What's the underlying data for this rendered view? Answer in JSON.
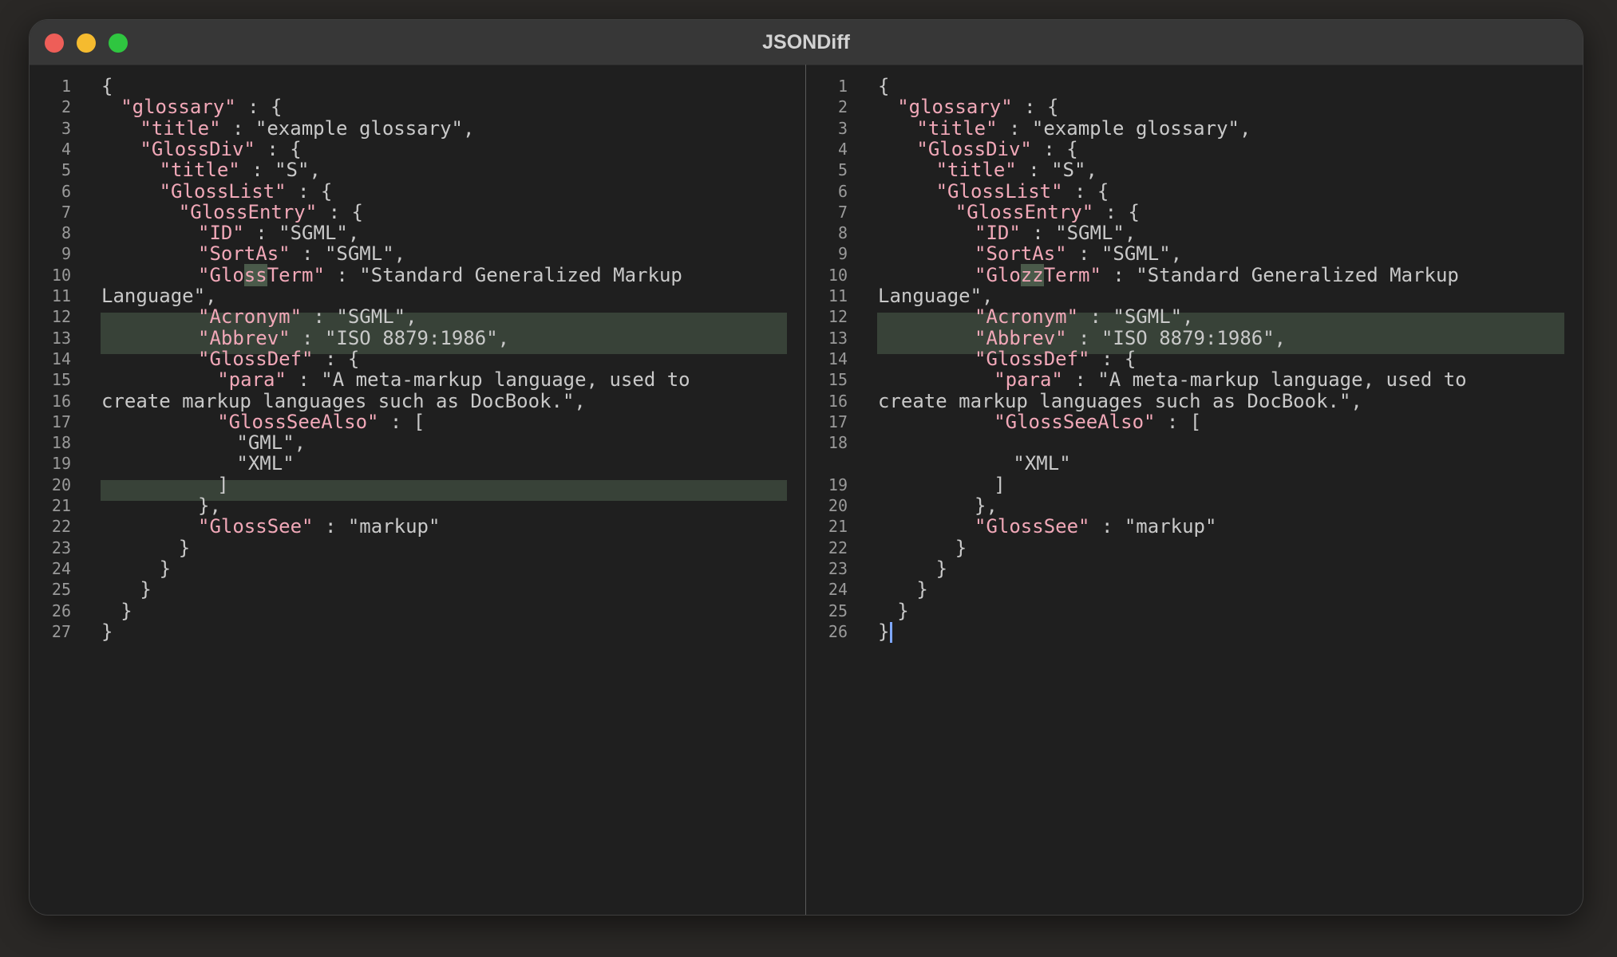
{
  "window": {
    "title": "JSONDiff"
  },
  "left_pane": {
    "line_numbers": [
      "1",
      "2",
      "3",
      "4",
      "5",
      "6",
      "7",
      "8",
      "9",
      "10",
      "11",
      "12",
      "13",
      "14",
      "15",
      "16",
      "17",
      "18",
      "19",
      "20",
      "21",
      "22",
      "23",
      "24",
      "25",
      "26",
      "27"
    ],
    "lines": {
      "l1": "{",
      "l2_key": "\"glossary\"",
      "l2_rest": " : {",
      "l3_key": "\"title\"",
      "l3_rest": " : \"example glossary\",",
      "l4_key": "\"GlossDiv\"",
      "l4_rest": " : {",
      "l5_key": "\"title\"",
      "l5_rest": " : \"S\",",
      "l6_key": "\"GlossList\"",
      "l6_rest": " : {",
      "l7_key": "\"GlossEntry\"",
      "l7_rest": " : {",
      "l8_key": "\"ID\"",
      "l8_rest": " : \"SGML\",",
      "l9_key": "\"SortAs\"",
      "l9_rest": " : \"SGML\",",
      "l10_key_a": "\"Glo",
      "l10_key_changed": "ss",
      "l10_key_b": "Term\"",
      "l10_rest": " : \"Standard Generalized Markup",
      "l11": "Language\",",
      "l12_key": "\"Acronym\"",
      "l12_rest": " : \"SGML\",",
      "l13_key": "\"Abbrev\"",
      "l13_rest": " : \"ISO 8879:1986\",",
      "l14_key": "\"GlossDef\"",
      "l14_rest": " : {",
      "l15_key": "\"para\"",
      "l15_rest": " : \"A meta-markup language, used to",
      "l16": "create markup languages such as DocBook.\",",
      "l17_key": "\"GlossSeeAlso\"",
      "l17_rest": " : [",
      "l18": "\"GML\",",
      "l19": "\"XML\"",
      "l20": "]",
      "l21": "},",
      "l22_key": "\"GlossSee\"",
      "l22_rest": " : \"markup\"",
      "l23": "}",
      "l24": "}",
      "l25": "}",
      "l26": "}",
      "l27": "}"
    }
  },
  "right_pane": {
    "line_numbers": [
      "1",
      "2",
      "3",
      "4",
      "5",
      "6",
      "7",
      "8",
      "9",
      "10",
      "11",
      "12",
      "13",
      "14",
      "15",
      "16",
      "17",
      "18",
      "",
      "19",
      "20",
      "21",
      "22",
      "23",
      "24",
      "25",
      "26"
    ],
    "lines": {
      "l1": "{",
      "l2_key": "\"glossary\"",
      "l2_rest": " : {",
      "l3_key": "\"title\"",
      "l3_rest": " : \"example glossary\",",
      "l4_key": "\"GlossDiv\"",
      "l4_rest": " : {",
      "l5_key": "\"title\"",
      "l5_rest": " : \"S\",",
      "l6_key": "\"GlossList\"",
      "l6_rest": " : {",
      "l7_key": "\"GlossEntry\"",
      "l7_rest": " : {",
      "l8_key": "\"ID\"",
      "l8_rest": " : \"SGML\",",
      "l9_key": "\"SortAs\"",
      "l9_rest": " : \"SGML\",",
      "l10_key_a": "\"Glo",
      "l10_key_changed": "zz",
      "l10_key_b": "Term\"",
      "l10_rest": " : \"Standard Generalized Markup",
      "l11": "Language\",",
      "l12_key": "\"Acronym\"",
      "l12_rest": " : \"SGML\",",
      "l13_key": "\"Abbrev\"",
      "l13_rest": " : \"ISO 8879:1986\",",
      "l14_key": "\"GlossDef\"",
      "l14_rest": " : {",
      "l15_key": "\"para\"",
      "l15_rest": " : \"A meta-markup language, used to",
      "l16": "create markup languages such as DocBook.\",",
      "l17_key": "\"GlossSeeAlso\"",
      "l17_rest": " : [",
      "l19": "\"XML\"",
      "l20": "]",
      "l21": "},",
      "l22_key": "\"GlossSee\"",
      "l22_rest": " : \"markup\"",
      "l23": "}",
      "l24": "}",
      "l25": "}",
      "l26": "}",
      "l27": "}"
    }
  },
  "colors": {
    "window_bg": "#1f1f1f",
    "titlebar_bg": "#373737",
    "diff_highlight": "#384238",
    "diff_changed_chars": "#4a5a4a",
    "json_key": "#f1a8b8",
    "text": "#c9c9c9",
    "line_number": "#9a9a9a",
    "cursor": "#7fa8ff"
  }
}
